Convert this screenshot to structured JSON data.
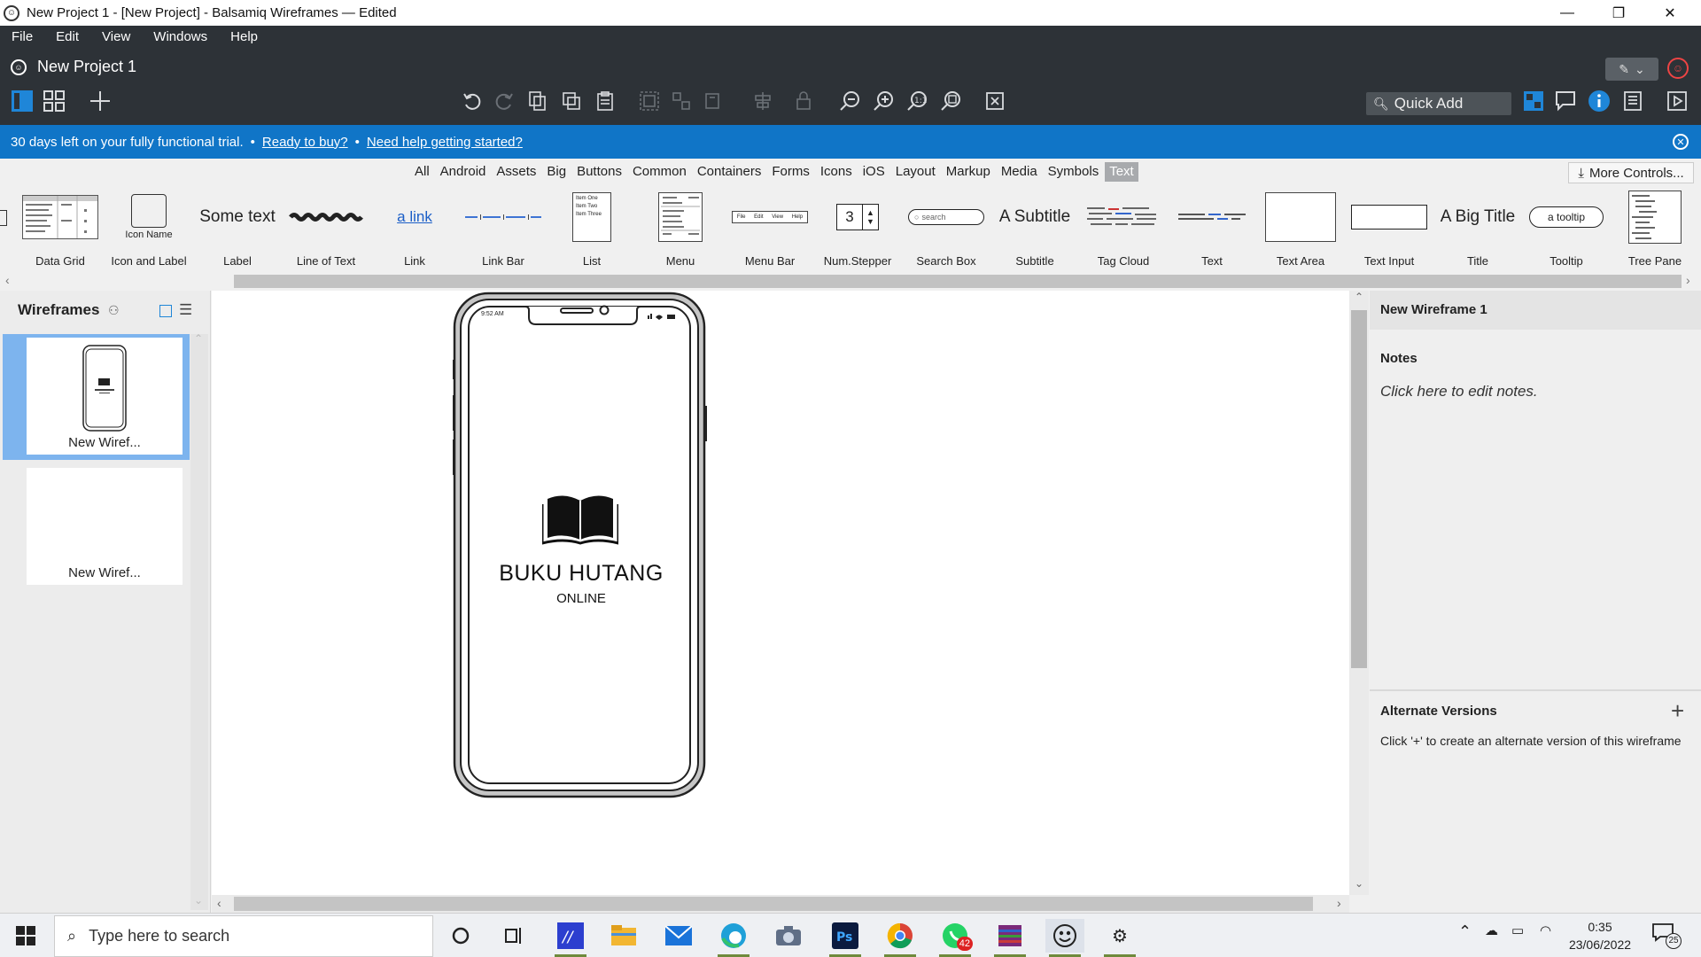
{
  "window": {
    "title": "New Project 1 - [New Project] - Balsamiq Wireframes — Edited",
    "minimize_icon": "minimize-icon",
    "restore_icon": "restore-icon",
    "close_icon": "close-icon"
  },
  "menubar": [
    "File",
    "Edit",
    "View",
    "Windows",
    "Help"
  ],
  "project": {
    "name": "New Project 1"
  },
  "quick_add": {
    "placeholder": "Quick Add"
  },
  "trial_banner": {
    "message": "30 days left on your fully functional trial.",
    "dot": "•",
    "buy_link": "Ready to buy?",
    "help_link": "Need help getting started?"
  },
  "categories": {
    "items": [
      "All",
      "Android",
      "Assets",
      "Big",
      "Buttons",
      "Common",
      "Containers",
      "Forms",
      "Icons",
      "iOS",
      "Layout",
      "Markup",
      "Media",
      "Symbols",
      "Text"
    ],
    "active": "Text",
    "more_controls": "More Controls..."
  },
  "components": [
    {
      "label": "Data Grid"
    },
    {
      "label": "Icon and Label",
      "preview": "Icon Name"
    },
    {
      "label": "Label",
      "preview": "Some text"
    },
    {
      "label": "Line of Text"
    },
    {
      "label": "Link",
      "preview": "a link"
    },
    {
      "label": "Link Bar"
    },
    {
      "label": "List",
      "preview_items": [
        "Item One",
        "Item Two",
        "Item Three"
      ]
    },
    {
      "label": "Menu"
    },
    {
      "label": "Menu Bar",
      "preview_items": [
        "File",
        "Edit",
        "View",
        "Help"
      ]
    },
    {
      "label": "Num.Stepper",
      "preview": "3"
    },
    {
      "label": "Search Box",
      "preview": "search"
    },
    {
      "label": "Subtitle",
      "preview": "A Subtitle"
    },
    {
      "label": "Tag Cloud"
    },
    {
      "label": "Text"
    },
    {
      "label": "Text Area"
    },
    {
      "label": "Text Input"
    },
    {
      "label": "Title",
      "preview": "A Big Title"
    },
    {
      "label": "Tooltip",
      "preview": "a tooltip"
    },
    {
      "label": "Tree Pane"
    }
  ],
  "wireframes_panel": {
    "heading": "Wireframes",
    "items": [
      {
        "caption": "New Wiref...",
        "selected": true
      },
      {
        "caption": "New Wiref...",
        "selected": false
      }
    ]
  },
  "canvas": {
    "phone": {
      "status_time": "9:52 AM",
      "app_title": "BUKU HUTANG",
      "app_subtitle": "ONLINE",
      "logo_icon": "open-book-icon"
    }
  },
  "inspector": {
    "title": "New Wireframe 1",
    "notes_heading": "Notes",
    "notes_placeholder": "Click here to edit notes.",
    "alt_heading": "Alternate Versions",
    "alt_add": "+",
    "alt_text": "Click '+' to create an alternate version of this wireframe"
  },
  "taskbar": {
    "search_placeholder": "Type here to search",
    "whatsapp_badge": "42",
    "notification_count": "25",
    "time": "0:35",
    "date": "23/06/2022"
  },
  "colors": {
    "header_bg": "#2d3237",
    "banner_bg": "#1075c7",
    "selection": "#7db4ee",
    "active_tab": "#a8aaad"
  }
}
